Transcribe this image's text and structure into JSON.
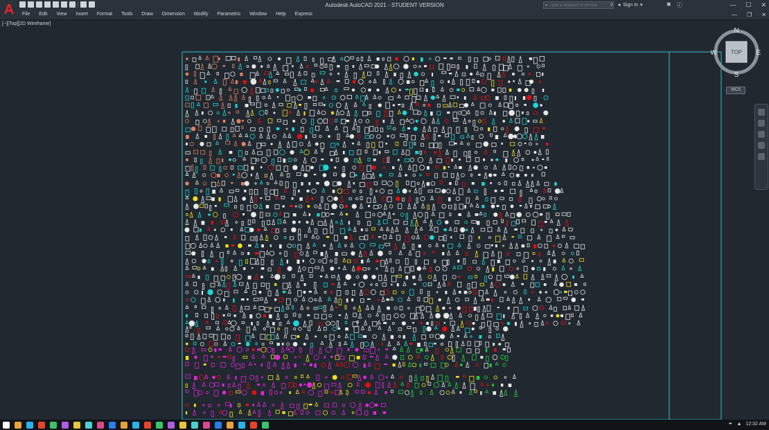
{
  "window": {
    "title": "Autodesk AutoCAD 2021 - STUDENT VERSION",
    "logo": "A"
  },
  "menu": [
    "File",
    "Edit",
    "View",
    "Insert",
    "Format",
    "Tools",
    "Draw",
    "Dimension",
    "Modify",
    "Parametric",
    "Window",
    "Help",
    "Express"
  ],
  "search": {
    "placeholder": "Type a keyword or phrase"
  },
  "account": {
    "signin_label": "Sign In"
  },
  "viewport": {
    "label": "[−][Top][2D Wireframe]"
  },
  "viewcube": {
    "north": "N",
    "south": "S",
    "east": "E",
    "west": "W",
    "face": "TOP",
    "wcs": "WCS"
  },
  "status": {
    "clock": "12:32 AM"
  },
  "colors": {
    "background": "#212830",
    "frame": "#2ec4c4",
    "symbol_white": "#e6e6e6",
    "symbol_cyan": "#1fd6d6",
    "symbol_red": "#e01010",
    "symbol_magenta": "#e024d8",
    "symbol_yellow": "#f0e020",
    "symbol_green": "#20d040",
    "symbol_orange": "#e08060"
  },
  "taskbar_icons": [
    "windows-start-icon",
    "search-icon",
    "file-explorer-icon",
    "onedrive-icon",
    "store-icon",
    "edge-icon",
    "chrome-icon",
    "firefox-icon",
    "opera-icon",
    "media-icon",
    "whatsapp-icon",
    "telegram-icon",
    "pdf-icon",
    "autocad-icon",
    "autocad-icon-2",
    "revit-icon",
    "navisworks-icon",
    "photoshop-icon",
    "premiere-icon",
    "audition-icon",
    "excel-icon",
    "word-icon",
    "office-icon"
  ]
}
